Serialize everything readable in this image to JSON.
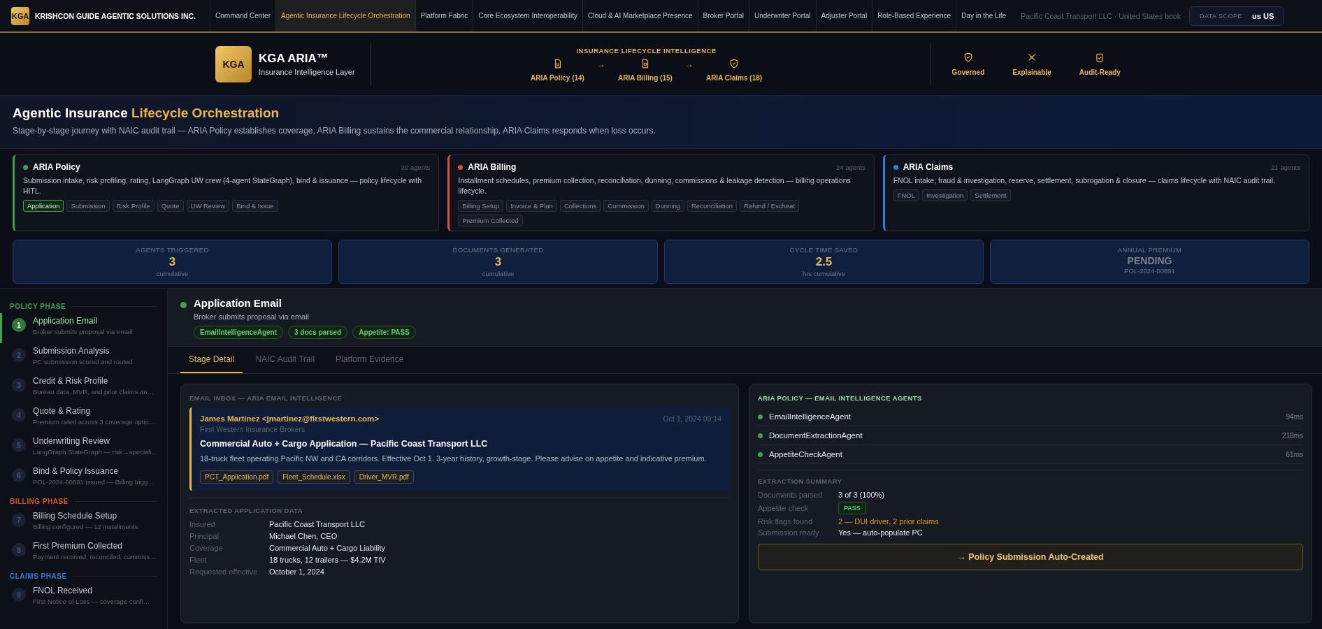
{
  "topnav": {
    "logo": "KGA",
    "brand": "KRISHCON GUIDE AGENTIC SOLUTIONS INC.",
    "items": [
      {
        "label": "Command Center",
        "selected": false
      },
      {
        "label": "Agentic Insurance Lifecycle Orchestration",
        "selected": true
      },
      {
        "label": "Platform Fabric",
        "selected": false
      },
      {
        "label": "Core Ecosystem Interoperability",
        "selected": false
      },
      {
        "label": "Cloud & AI Marketplace Presence",
        "selected": false
      },
      {
        "label": "Broker Portal",
        "selected": false
      },
      {
        "label": "Underwriter Portal",
        "selected": false
      },
      {
        "label": "Adjuster Portal",
        "selected": false
      },
      {
        "label": "Role-Based Experience",
        "selected": false
      },
      {
        "label": "Day in the Life",
        "selected": false
      }
    ],
    "context": "Pacific Coast Transport LLC · United States book",
    "scope_label": "DATA SCOPE",
    "scope_value": "us US"
  },
  "header": {
    "logo": "KGA",
    "title": "KGA ARIA™",
    "subtitle": "Insurance Intelligence Layer",
    "flow_title": "INSURANCE LIFECYCLE INTELLIGENCE",
    "flow": [
      {
        "kind": "policy",
        "label": "ARIA Policy (14)"
      },
      {
        "kind": "billing",
        "label": "ARIA Billing (15)"
      },
      {
        "kind": "claims",
        "label": "ARIA Claims (18)"
      }
    ],
    "arrows": [
      "→",
      "→"
    ],
    "badges": [
      {
        "kind": "shield",
        "label": "Governed"
      },
      {
        "kind": "nodes",
        "label": "Explainable"
      },
      {
        "kind": "clipboard",
        "label": "Audit-Ready"
      }
    ]
  },
  "page": {
    "title": "Agentic Insurance **Lifecycle Orchestration**",
    "subtitle": "Stage-by-stage journey with NAIC audit trail — ARIA Policy establishes coverage, ARIA Billing sustains the commercial relationship, ARIA Claims responds when loss occurs."
  },
  "products": [
    {
      "name": "ARIA Policy",
      "color": "#3fa34d",
      "count": "20 agents",
      "description": "Submission intake, risk profiling, rating, LangGraph UW crew (4-agent StateGraph), bind & issuance — policy lifecycle with HITL.",
      "stages": [
        {
          "label": "Application",
          "selected": true
        },
        {
          "label": "Submission",
          "selected": false
        },
        {
          "label": "Risk Profile",
          "selected": false
        },
        {
          "label": "Quote",
          "selected": false
        },
        {
          "label": "UW Review",
          "selected": false
        },
        {
          "label": "Bind & Issue",
          "selected": false
        }
      ]
    },
    {
      "name": "ARIA Billing",
      "color": "#d9532b",
      "count": "24 agents",
      "description": "Installment schedules, premium collection, reconciliation, dunning, commissions & leakage detection — billing operations lifecycle.",
      "stages": [
        {
          "label": "Billing Setup",
          "selected": false
        },
        {
          "label": "Invoice & Plan",
          "selected": false
        },
        {
          "label": "Collections",
          "selected": false
        },
        {
          "label": "Commission",
          "selected": false
        },
        {
          "label": "Dunning",
          "selected": false
        },
        {
          "label": "Reconciliation",
          "selected": false
        },
        {
          "label": "Refund / Escheat",
          "selected": false
        },
        {
          "label": "Premium Collected",
          "selected": false
        }
      ]
    },
    {
      "name": "ARIA Claims",
      "color": "#2f7fd6",
      "count": "21 agents",
      "description": "FNOL intake, fraud & investigation, reserve, settlement, subrogation & closure — claims lifecycle with NAIC audit trail.",
      "stages": [
        {
          "label": "FNOL",
          "selected": false
        },
        {
          "label": "Investigation",
          "selected": false
        },
        {
          "label": "Settlement",
          "selected": false
        }
      ]
    }
  ],
  "stats": [
    {
      "label": "AGENTS TRIGGERED",
      "value": "3",
      "sub": "cumulative",
      "pending": false
    },
    {
      "label": "DOCUMENTS GENERATED",
      "value": "3",
      "sub": "cumulative",
      "pending": false
    },
    {
      "label": "CYCLE TIME SAVED",
      "value": "2.5",
      "sub": "hrs cumulative",
      "pending": false
    },
    {
      "label": "ANNUAL PREMIUM",
      "value": "PENDING",
      "sub": "POL-2024-00891",
      "pending": true
    }
  ],
  "phases": [
    {
      "name": "POLICY PHASE",
      "color": "#3fa34d",
      "steps": [
        {
          "number": "1",
          "title": "Application Email",
          "sub": "Broker submits proposal via email",
          "selected": true
        },
        {
          "number": "2",
          "title": "Submission Analysis",
          "sub": "PC submission scored and routed",
          "selected": false
        },
        {
          "number": "3",
          "title": "Credit & Risk Profile",
          "sub": "Bureau data, MVR, and prior claims an…",
          "selected": false
        },
        {
          "number": "4",
          "title": "Quote & Rating",
          "sub": "Premium rated across 3 coverage optio…",
          "selected": false
        },
        {
          "number": "5",
          "title": "Underwriting Review",
          "sub": "LangGraph StateGraph — risk→speciali…",
          "selected": false
        },
        {
          "number": "6",
          "title": "Bind & Policy Issuance",
          "sub": "POL-2024-00891 issued — Billing trigg…",
          "selected": false
        }
      ]
    },
    {
      "name": "BILLING PHASE",
      "color": "#d9532b",
      "steps": [
        {
          "number": "7",
          "title": "Billing Schedule Setup",
          "sub": "Billing configured — 12 installments",
          "selected": false
        },
        {
          "number": "8",
          "title": "First Premium Collected",
          "sub": "Payment received, reconciled, commiss…",
          "selected": false
        }
      ]
    },
    {
      "name": "CLAIMS PHASE",
      "color": "#2f7fd6",
      "steps": [
        {
          "number": "9",
          "title": "FNOL Received",
          "sub": "First Notice of Loss — coverage confi…",
          "selected": false
        }
      ]
    }
  ],
  "stage": {
    "title": "Application Email",
    "subtitle": "Broker submits proposal via email",
    "tags": [
      "EmailIntelligenceAgent",
      "3 docs parsed",
      "Appetite: PASS"
    ]
  },
  "tabs": [
    {
      "label": "Stage Detail",
      "selected": true
    },
    {
      "label": "NAIC Audit Trail",
      "selected": false
    },
    {
      "label": "Platform Evidence",
      "selected": false
    }
  ],
  "email": {
    "section": "EMAIL INBOX — ARIA EMAIL INTELLIGENCE",
    "from": "James Martinez <jmartinez@firstwestern.com>",
    "date": "Oct 1, 2024 09:14",
    "org": "First Western Insurance Brokers",
    "subject": "Commercial Auto + Cargo Application — Pacific Coast Transport LLC",
    "body": "18-truck fleet operating Pacific NW and CA corridors. Effective Oct 1. 3-year history, growth-stage. Please advise on appetite and indicative premium.",
    "attachments": [
      "PCT_Application.pdf",
      "Fleet_Schedule.xlsx",
      "Driver_MVR.pdf"
    ]
  },
  "extracted": {
    "section": "EXTRACTED APPLICATION DATA",
    "rows": [
      {
        "label": "Insured",
        "value": "Pacific Coast Transport LLC"
      },
      {
        "label": "Principal",
        "value": "Michael Chen, CEO"
      },
      {
        "label": "Coverage",
        "value": "Commercial Auto + Cargo Liability"
      },
      {
        "label": "Fleet",
        "value": "18 trucks, 12 trailers — $4.2M TIV"
      },
      {
        "label": "Requested effective",
        "value": "October 1, 2024"
      }
    ]
  },
  "agents": {
    "section": "ARIA POLICY — EMAIL INTELLIGENCE AGENTS",
    "items": [
      {
        "name": "EmailIntelligenceAgent",
        "time": "94ms",
        "color": "#3fa34d"
      },
      {
        "name": "DocumentExtractionAgent",
        "time": "218ms",
        "color": "#3fa34d"
      },
      {
        "name": "AppetiteCheckAgent",
        "time": "61ms",
        "color": "#3fa34d"
      }
    ]
  },
  "summary": {
    "section": "EXTRACTION SUMMARY",
    "rows": [
      {
        "label": "Documents parsed",
        "value": "3 of 3 (100%)",
        "kind": "text"
      },
      {
        "label": "Appetite check",
        "value": "PASS",
        "kind": "badge"
      },
      {
        "label": "Risk flags found",
        "value": "2 — DUI driver, 2 prior claims",
        "kind": "warning"
      },
      {
        "label": "Submission ready",
        "value": "Yes — auto-populate PC",
        "kind": "text"
      }
    ]
  },
  "action": "→ Policy Submission Auto-Created"
}
